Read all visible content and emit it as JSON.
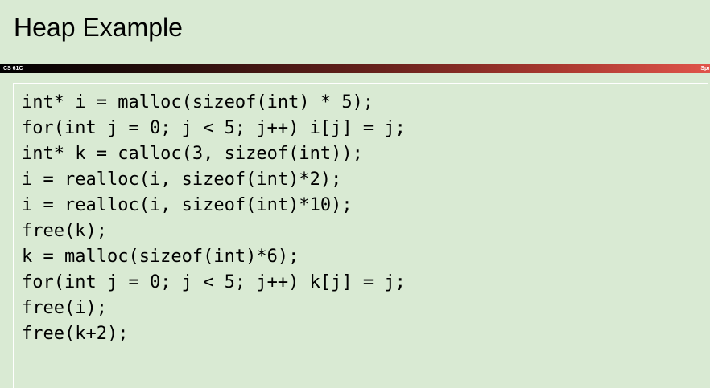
{
  "slide": {
    "title": "Heap Example",
    "footer_left": "CS 61C",
    "footer_right": "Spr"
  },
  "code": {
    "lines": [
      "int* i = malloc(sizeof(int) * 5);",
      "for(int j = 0; j < 5; j++) i[j] = j;",
      "int* k = calloc(3, sizeof(int));",
      "i = realloc(i, sizeof(int)*2);",
      "i = realloc(i, sizeof(int)*10);",
      "free(k);",
      "k = malloc(sizeof(int)*6);",
      "for(int j = 0; j < 5; j++) k[j] = j;",
      "free(i);",
      "free(k+2);"
    ]
  }
}
